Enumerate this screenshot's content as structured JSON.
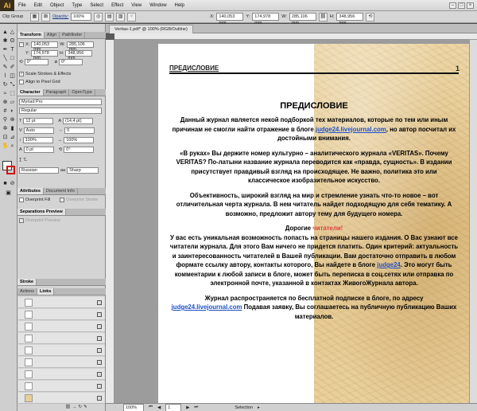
{
  "app": {
    "logo": "Ai",
    "menu": [
      "File",
      "Edit",
      "Object",
      "Type",
      "Select",
      "Effect",
      "View",
      "Window",
      "Help"
    ]
  },
  "control": {
    "selection_type": "Clip Group",
    "opacity_label": "Opacity:",
    "opacity_value": "100%",
    "x_label": "X:",
    "x_value": "140,053 mm",
    "y_label": "Y:",
    "y_value": "174,978 mm",
    "w_label": "W:",
    "w_value": "285,106 mm",
    "h_label": "H:",
    "h_value": "348,956 mm"
  },
  "panels": {
    "transform_tabs": [
      "Transform",
      "Align",
      "Pathfinder"
    ],
    "transform": {
      "x_label": "X:",
      "x_value": "140,053 mm",
      "y_label": "Y:",
      "y_value": "174,978 mm",
      "w_label": "W:",
      "w_value": "285,106 mm",
      "h_label": "H:",
      "h_value": "348,956 mm",
      "rotate_value": "0°",
      "shear_value": "0°",
      "scale_strokes": "Scale Strokes & Effects",
      "align_pixel": "Align to Pixel Grid"
    },
    "character_tabs": [
      "Character",
      "Paragraph",
      "OpenType"
    ],
    "character": {
      "font": "Myriad Pro",
      "style": "Regular",
      "size": "12 pt",
      "leading": "(14,4 pt)",
      "kerning": "Auto",
      "tracking": "0",
      "vscale": "100%",
      "hscale": "100%",
      "baseline": "0 pt",
      "rotation": "0°",
      "language": "Russian",
      "antialias": "Sharp"
    },
    "attributes_tabs": [
      "Attributes",
      "Document Info"
    ],
    "attributes": {
      "overprint_fill": "Overprint Fill",
      "overprint_stroke": "Overprint Stroke"
    },
    "separations_tabs": [
      "Separations Preview"
    ],
    "separations": {
      "overprint_preview": "Overprint Preview"
    },
    "stroke_tabs": [
      "Stroke"
    ],
    "layers_tabs": [
      "Actions",
      "Links"
    ]
  },
  "document": {
    "tab_title": "Veritas-1.pdf* @ 100% (RGB/Outline)",
    "page_header": "ПРЕДИСЛОВИЕ",
    "page_number": "1",
    "title": "ПРЕДИСЛОВИЕ",
    "p1_a": "Данный журнал является некой подборкой тех материалов, которые по тем или иным причинам не смогли найти отражение в блоге ",
    "p1_link": "judge24.livejournal.com",
    "p1_b": ", но автор посчитал их достойными внимания.",
    "p2": "«В руках» Вы держите номер культурно – аналитического журнала «VERITAS». Почему VERITAS? По-латыни название журнала переводится как «правда, сущность». В издании присутствует правдивый взгляд на происходящее. Не важно, политика это или классическое изобразительное искусство.",
    "p3": "Объективность, широкий взгляд на мир и стремление узнать что-то новое – вот отличительная черта журнала. В нем читатель найдет подходящую для себя тематику. А возможно, предложит автору тему для будущего номера.",
    "p4_a": "Дорогие ",
    "p4_hl": "читатели!",
    "p5_a": "У вас есть уникальная возможность попасть на страницы нашего издания. О Вас узнают все читатели журнала. Для этого Вам ничего не придется платить. Один критерий: актуальность и заинтересованность читателей в Вашей публикации. Вам достаточно отправить в любом формате ссылку автору, контакты которого, Вы найдете в блоге ",
    "p5_link": "judge24",
    "p5_b": ". Это могут быть комментарии к любой записи в блоге, может быть переписка в соц.сетях или отправка по электронной почте, указанной в контактах ЖивогоЖурнала автора.",
    "p6_a": "Журнал распространяется по бесплатной подписке в блоге, по адресу ",
    "p6_link": "judge24.livejournal.com",
    "p6_b": " Подавая заявку, Вы соглашаетесь на публичную публикацию Ваших материалов."
  },
  "status": {
    "zoom": "100%",
    "page": "1",
    "tool": "Selection"
  },
  "colors": {
    "parchment": "#e6cb93",
    "link": "#1e4fc7",
    "highlight": "#e04040"
  }
}
